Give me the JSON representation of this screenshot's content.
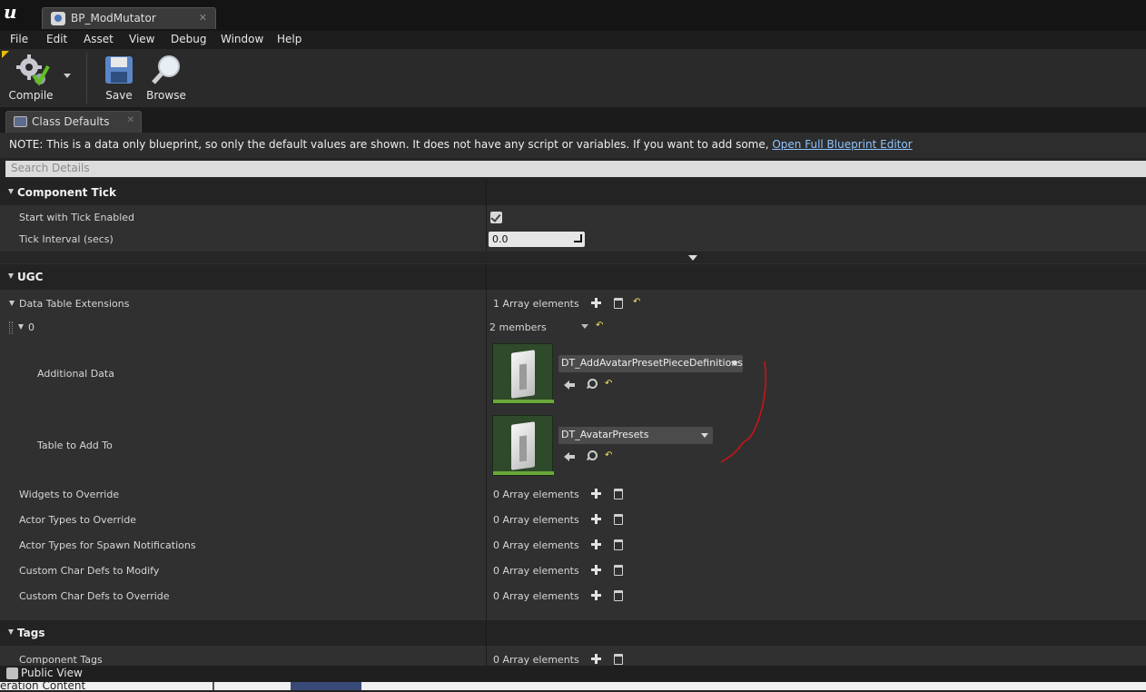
{
  "window": {
    "tab_title": "BP_ModMutator",
    "tab_close": "✕"
  },
  "menu": [
    "File",
    "Edit",
    "Asset",
    "View",
    "Debug",
    "Window",
    "Help"
  ],
  "toolbar": {
    "compile_label": "Compile",
    "save_label": "Save",
    "browse_label": "Browse"
  },
  "panel": {
    "tab_label": "Class Defaults",
    "tab_close": "✕",
    "note_text": "NOTE: This is a data only blueprint, so only the default values are shown.  It does not have any script or variables.  If you want to add some, ",
    "note_link": "Open Full Blueprint Editor",
    "search_placeholder": "Search Details"
  },
  "categories": {
    "component_tick": "Component Tick",
    "ugc": "UGC",
    "tags": "Tags"
  },
  "component_tick": {
    "start_with_tick_label": "Start with Tick Enabled",
    "start_with_tick_checked": true,
    "tick_interval_label": "Tick Interval (secs)",
    "tick_interval_value": "0.0"
  },
  "ugc": {
    "data_table_ext_label": "Data Table Extensions",
    "data_table_ext_value": "1 Array elements",
    "element_index": "0",
    "element_members": "2 members",
    "additional_data_label": "Additional Data",
    "additional_data_asset": "DT_AddAvatarPresetPieceDefinitions",
    "table_to_add_label": "Table to Add To",
    "table_to_add_asset": "DT_AvatarPresets",
    "rows": [
      {
        "label": "Widgets to Override",
        "value": "0 Array elements"
      },
      {
        "label": "Actor Types to Override",
        "value": "0 Array elements"
      },
      {
        "label": "Actor Types for Spawn Notifications",
        "value": "0 Array elements"
      },
      {
        "label": "Custom Char Defs to Modify",
        "value": "0 Array elements"
      },
      {
        "label": "Custom Char Defs to Override",
        "value": "0 Array elements"
      }
    ]
  },
  "tags": {
    "component_tags_label": "Component Tags",
    "component_tags_value": "0 Array elements"
  },
  "footer": {
    "public_view_label": "Public View",
    "public_view_checked": false
  },
  "bottom_strip_text": "eration Content",
  "colors": {
    "accent_link": "#8ec4ff",
    "annotation_red": "#c81414",
    "thumb_bar": "#6aa83a"
  }
}
